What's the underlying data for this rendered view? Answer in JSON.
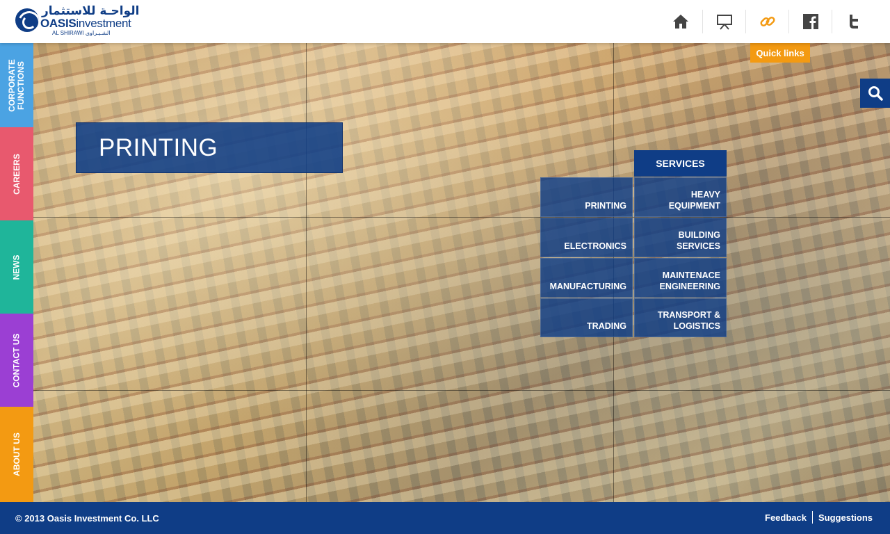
{
  "header": {
    "logo_arabic": "الواحـة للاستثمار",
    "logo_name_bold": "OASIS",
    "logo_name_rest": "investment",
    "logo_sub": "AL SHIRAWI الشـيـراوي",
    "icons": [
      "home-icon",
      "presentation-icon",
      "link-icon",
      "facebook-icon",
      "twitter-icon"
    ],
    "link_icon_color": "#f39a12"
  },
  "sidenav": [
    {
      "label": "CORPORATE FUNCTIONS",
      "color": "#4ba3e3"
    },
    {
      "label": "CAREERS",
      "color": "#e8596e"
    },
    {
      "label": "NEWS",
      "color": "#1fb59a"
    },
    {
      "label": "CONTACT US",
      "color": "#9b3fd3"
    },
    {
      "label": "ABOUT US",
      "color": "#f39a12"
    }
  ],
  "quick_links": "Quick links",
  "page_title": "PRINTING",
  "services": {
    "header": "SERVICES",
    "items": [
      "PRINTING",
      "HEAVY EQUIPMENT",
      "ELECTRONICS",
      "BUILDING SERVICES",
      "MANUFACTURING",
      "MAINTENACE ENGINEERING",
      "TRADING",
      "TRANSPORT & LOGISTICS"
    ]
  },
  "footer": {
    "copyright": "© 2013 Oasis Investment Co. LLC",
    "links": [
      "Feedback",
      "Suggestions"
    ]
  },
  "colors": {
    "brand_blue": "#0f3d86",
    "accent_orange": "#f39a12"
  }
}
